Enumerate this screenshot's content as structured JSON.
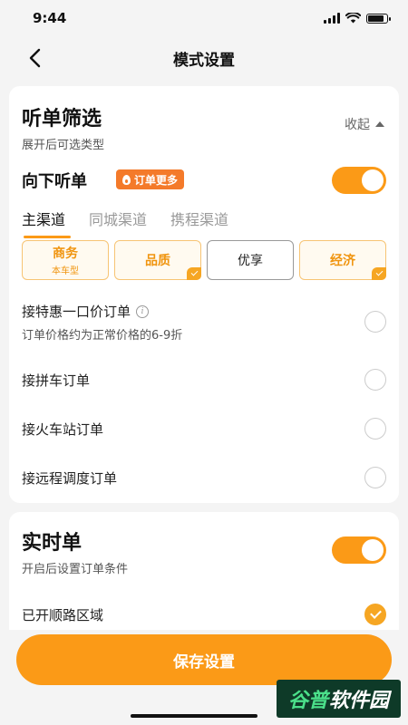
{
  "status_bar": {
    "time": "9:44",
    "battery_level": 0.85
  },
  "nav": {
    "title": "模式设置"
  },
  "listen_filter": {
    "title": "听单筛选",
    "subtitle": "展开后可选类型",
    "collapse_label": "收起",
    "downward": {
      "label": "向下听单",
      "badge": "订单更多",
      "enabled": true
    },
    "tabs": [
      {
        "label": "主渠道",
        "active": true
      },
      {
        "label": "同城渠道",
        "active": false
      },
      {
        "label": "携程渠道",
        "active": false
      }
    ],
    "options": [
      {
        "label": "商务",
        "sub": "本车型",
        "selected": true,
        "checked": false
      },
      {
        "label": "品质",
        "sub": "",
        "selected": true,
        "checked": true
      },
      {
        "label": "优享",
        "sub": "",
        "selected": false,
        "checked": false
      },
      {
        "label": "经济",
        "sub": "",
        "selected": true,
        "checked": true
      }
    ],
    "check_items": [
      {
        "label": "接特惠一口价订单",
        "sub": "订单价格约为正常价格的6-9折",
        "checked": false,
        "has_info": true
      },
      {
        "label": "接拼车订单",
        "sub": "",
        "checked": false,
        "has_info": false
      },
      {
        "label": "接火车站订单",
        "sub": "",
        "checked": false,
        "has_info": false
      },
      {
        "label": "接远程调度订单",
        "sub": "",
        "checked": false,
        "has_info": false
      }
    ]
  },
  "realtime": {
    "title": "实时单",
    "subtitle": "开启后设置订单条件",
    "enabled": true,
    "route_area_label": "已开顺路区域",
    "route_area_checked": true
  },
  "save_button": {
    "label": "保存设置"
  },
  "watermark": {
    "part1": "谷普",
    "part2": "软件园"
  },
  "colors": {
    "accent": "#fb9a17",
    "badge": "#f47a2a",
    "option_text": "#f0940e"
  }
}
